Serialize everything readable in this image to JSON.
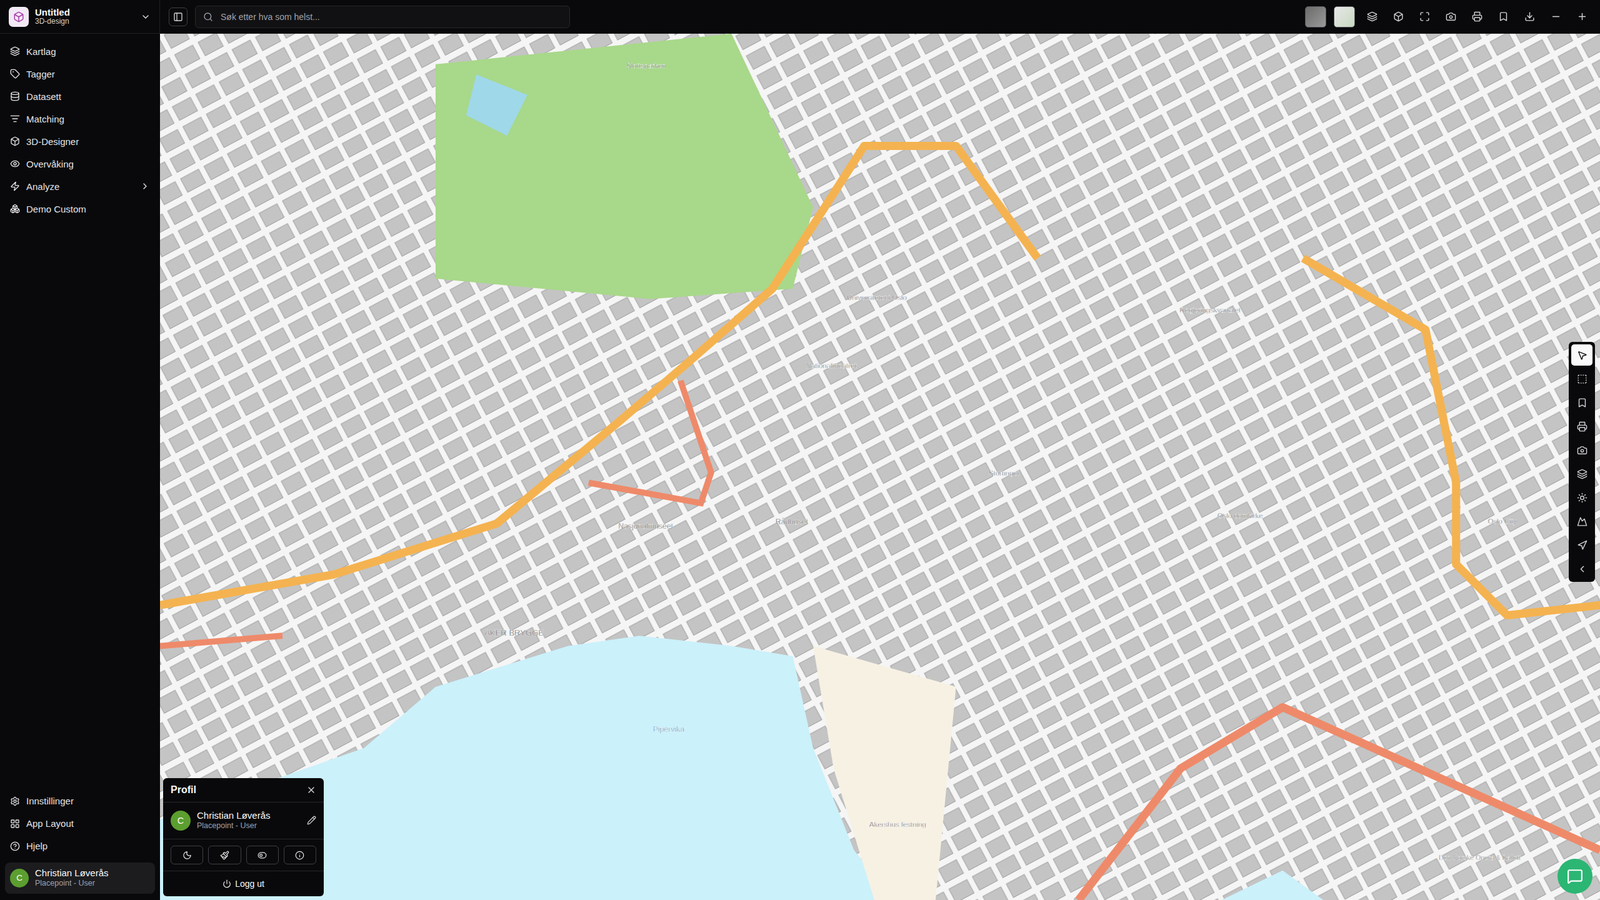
{
  "window": {
    "title": "Untitled",
    "subtitle": "3D-design"
  },
  "search": {
    "placeholder": "Søk etter hva som helst..."
  },
  "sidebar": {
    "items": [
      {
        "label": "Kartlag",
        "selected": false,
        "expandable": false
      },
      {
        "label": "Tagger",
        "selected": false,
        "expandable": false
      },
      {
        "label": "Datasett",
        "selected": false,
        "expandable": false
      },
      {
        "label": "Matching",
        "selected": false,
        "expandable": false
      },
      {
        "label": "3D-Designer",
        "selected": false,
        "expandable": false
      },
      {
        "label": "Overvåking",
        "selected": false,
        "expandable": false
      },
      {
        "label": "Analyze",
        "selected": false,
        "expandable": true
      },
      {
        "label": "Demo Custom",
        "selected": false,
        "expandable": false
      }
    ],
    "footer": [
      {
        "label": "Innstillinger"
      },
      {
        "label": "App Layout"
      },
      {
        "label": "Hjelp"
      }
    ]
  },
  "user": {
    "initial": "C",
    "name": "Christian Løverås",
    "role": "Placepoint - User"
  },
  "profile": {
    "title": "Profil",
    "logout": "Logg ut"
  },
  "map_tools": [
    {
      "kind": "pointer",
      "selected": true
    },
    {
      "kind": "select",
      "selected": false
    },
    {
      "kind": "bookmark",
      "selected": false
    },
    {
      "kind": "print",
      "selected": false
    },
    {
      "kind": "camera",
      "selected": false
    },
    {
      "kind": "layers",
      "selected": false
    },
    {
      "kind": "sun",
      "selected": false
    },
    {
      "kind": "terrain",
      "selected": false
    },
    {
      "kind": "navigate",
      "selected": false
    },
    {
      "kind": "collapse",
      "selected": false
    }
  ],
  "map": {
    "labels": [
      {
        "text": "Slottsparken"
      },
      {
        "text": "Nationaltheatret"
      },
      {
        "text": "Universitetet i Oslo"
      },
      {
        "text": "Rådhuset"
      },
      {
        "text": "Nasjonalmuseet"
      },
      {
        "text": "AKER BRYGGE"
      },
      {
        "text": "Pipervika"
      },
      {
        "text": "Akershus festning"
      },
      {
        "text": "Oslo domkirke"
      },
      {
        "text": "Regjeringskvartalet"
      },
      {
        "text": "Oslo City"
      },
      {
        "text": "Den Norske Opera & Ballett"
      },
      {
        "text": "Stortinget"
      }
    ]
  }
}
